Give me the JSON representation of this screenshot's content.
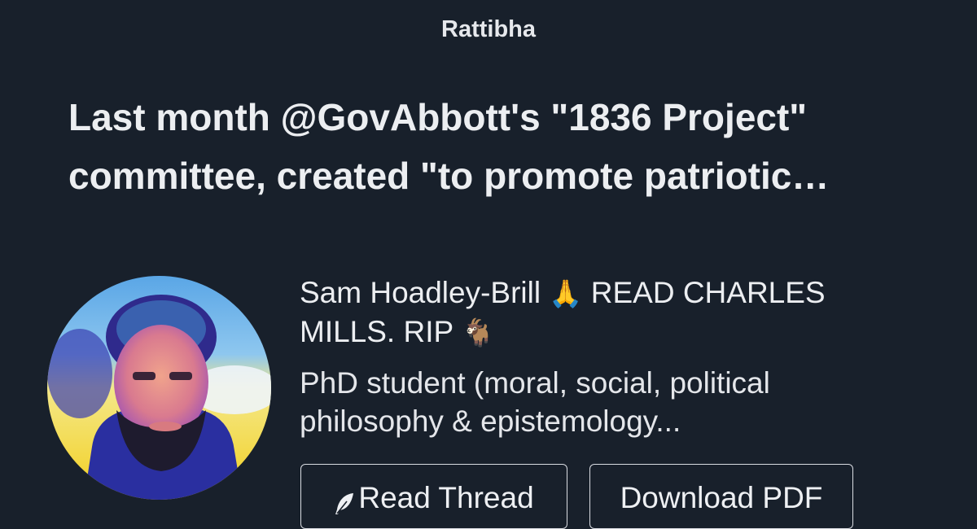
{
  "brand": "Rattibha",
  "headline": {
    "line1": "Last month @GovAbbott's \"1836 Project\"",
    "line2": "committee, created \"to promote patriotic…"
  },
  "author": {
    "line1": "Sam Hoadley-Brill",
    "emoji1": "🙏",
    "line1_rest": "READ CHARLES",
    "line2": "MILLS. RIP",
    "emoji2": "🐐"
  },
  "bio": {
    "line1": "PhD student (moral, social, political",
    "line2": "philosophy & epistemology..."
  },
  "buttons": {
    "read_thread": "Read Thread",
    "read_thread_icon": "feather-icon",
    "download_pdf": "Download PDF"
  },
  "colors": {
    "background": "#18202b",
    "text": "#eceef1",
    "button_border": "#d9dce2"
  }
}
